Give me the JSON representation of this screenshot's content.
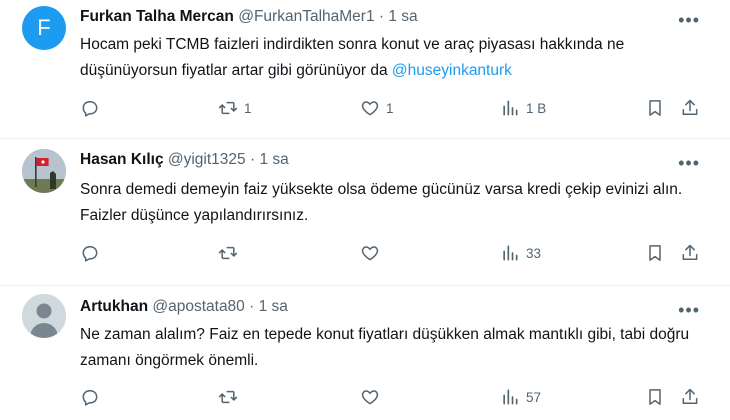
{
  "tweets": [
    {
      "avatar_letter": "F",
      "name": "Furkan Talha Mercan",
      "handle": "@FurkanTalhaMer1",
      "time": "1 sa",
      "text": "Hocam peki TCMB faizleri indirdikten sonra konut ve araç piyasası hakkında ne düşünüyorsun fiyatlar artar gibi görünüyor da ",
      "mention": "@huseyinkanturk",
      "retweets": "1",
      "likes": "1",
      "views": "1 B"
    },
    {
      "name": "Hasan Kılıç",
      "handle": "@yigit1325",
      "time": "1 sa",
      "text": "Sonra demedi demeyin faiz yüksekte olsa ödeme gücünüz varsa kredi çekip evinizi alın. Faizler düşünce yapılandırırsınız.",
      "views": "33"
    },
    {
      "name": "Artukhan",
      "handle": "@apostata80",
      "time": "1 sa",
      "text": "Ne zaman alalım? Faiz en tepede konut fiyatları düşükken almak mantıklı gibi, tabi doğru zamanı öngörmek önemli.",
      "views": "57"
    }
  ],
  "separator": "·",
  "more_glyph": "•••",
  "colors": {
    "accent": "#1d9bf0",
    "muted": "#536471",
    "text": "#0f1419"
  }
}
